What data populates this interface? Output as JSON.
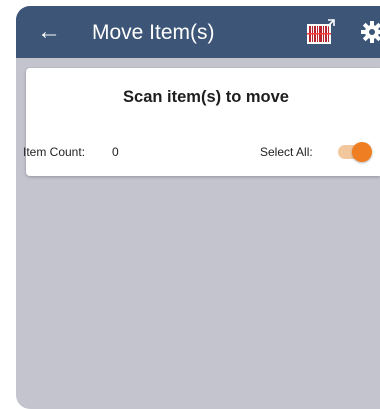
{
  "header": {
    "back_icon": "arrow-left-icon",
    "title": "Move Item(s)",
    "scan_icon": "barcode-scanner-icon",
    "settings_icon": "gear-icon",
    "background_color": "#3d5576"
  },
  "card": {
    "heading": "Scan item(s) to move",
    "item_count_label": "Item Count:",
    "item_count_value": "0",
    "select_all_label": "Select All:",
    "select_all_enabled": true,
    "toggle_color": "#ef7d22"
  },
  "colors": {
    "screen_background": "#c4c4cf",
    "card_background": "#ffffff"
  }
}
